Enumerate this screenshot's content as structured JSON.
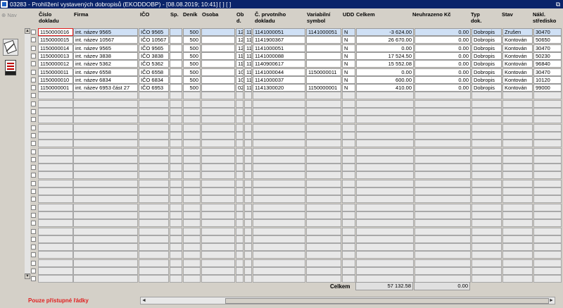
{
  "window": {
    "title": "03283 - Prohlížení vystavených dobropisů (EKODDOBP) - [08.08.2019; 10:41]  [ ]  [ ]"
  },
  "sidebar": {
    "nav_label": "Nav"
  },
  "columns": {
    "cislo": "Číslo\ndokladu",
    "firma": "Firma",
    "ico": "IČO",
    "sp": "Sp.",
    "denik": "Deník",
    "osoba": "Osoba",
    "obd": "Ob\nd.",
    "prvotni": "Č. prvotního\ndokladu",
    "varsym": "Variabilní\nsymbol",
    "udd": "UDD",
    "celkem": "Celkem",
    "neuhrazeno": "Neuhrazeno Kč",
    "typ": "Typ\ndok.",
    "stav": "Stav",
    "naklad": "Nákl.\nstředisko"
  },
  "rows": [
    {
      "cislo": "1150000016",
      "firma": "int. název 9565",
      "ico": "IČO 9565",
      "sp": "",
      "denik": "500",
      "osoba": "",
      "ob": "12",
      "d": "11",
      "prvotni": "1141000051",
      "varsym": "1141000051",
      "udd": "N",
      "celkem": "-3 624.00",
      "neuhrazeno": "0.00",
      "typ": "Dobropis",
      "stav": "Zrušen",
      "naklad": "30470"
    },
    {
      "cislo": "1150000015",
      "firma": "int. název 10567",
      "ico": "IČO 10567",
      "sp": "",
      "denik": "500",
      "osoba": "",
      "ob": "12",
      "d": "11",
      "prvotni": "1141900367",
      "varsym": "",
      "udd": "N",
      "celkem": "26 670.00",
      "neuhrazeno": "0.00",
      "typ": "Dobropis",
      "stav": "Kontován",
      "naklad": "50650"
    },
    {
      "cislo": "1150000014",
      "firma": "int. název 9565",
      "ico": "IČO 9565",
      "sp": "",
      "denik": "500",
      "osoba": "",
      "ob": "12",
      "d": "11",
      "prvotni": "1141000051",
      "varsym": "",
      "udd": "N",
      "celkem": "0.00",
      "neuhrazeno": "0.00",
      "typ": "Dobropis",
      "stav": "Kontován",
      "naklad": "30470"
    },
    {
      "cislo": "1150000013",
      "firma": "int. název 3838",
      "ico": "IČO 3838",
      "sp": "",
      "denik": "500",
      "osoba": "",
      "ob": "11",
      "d": "11",
      "prvotni": "1141000088",
      "varsym": "",
      "udd": "N",
      "celkem": "17 524.50",
      "neuhrazeno": "0.00",
      "typ": "Dobropis",
      "stav": "Kontován",
      "naklad": "50230"
    },
    {
      "cislo": "1150000012",
      "firma": "int. název 5362",
      "ico": "IČO 5362",
      "sp": "",
      "denik": "500",
      "osoba": "",
      "ob": "11",
      "d": "11",
      "prvotni": "1140900617",
      "varsym": "",
      "udd": "N",
      "celkem": "15 552.08",
      "neuhrazeno": "0.00",
      "typ": "Dobropis",
      "stav": "Kontován",
      "naklad": "96840"
    },
    {
      "cislo": "1150000011",
      "firma": "int. název 6558",
      "ico": "IČO 6558",
      "sp": "",
      "denik": "500",
      "osoba": "",
      "ob": "10",
      "d": "11",
      "prvotni": "1141000044",
      "varsym": "1150000011",
      "udd": "N",
      "celkem": "0.00",
      "neuhrazeno": "0.00",
      "typ": "Dobropis",
      "stav": "Kontován",
      "naklad": "30470"
    },
    {
      "cislo": "1150000010",
      "firma": "int. název 6834",
      "ico": "IČO 6834",
      "sp": "",
      "denik": "500",
      "osoba": "",
      "ob": "10",
      "d": "11",
      "prvotni": "1141000037",
      "varsym": "",
      "udd": "N",
      "celkem": "600.00",
      "neuhrazeno": "0.00",
      "typ": "Dobropis",
      "stav": "Kontován",
      "naklad": "10120"
    },
    {
      "cislo": "1150000001",
      "firma": "int. název 6953 část 27",
      "ico": "IČO 6953",
      "sp": "",
      "denik": "500",
      "osoba": "",
      "ob": "02",
      "d": "11",
      "prvotni": "1141300020",
      "varsym": "1150000001",
      "udd": "N",
      "celkem": "410.00",
      "neuhrazeno": "0.00",
      "typ": "Dobropis",
      "stav": "Kontován",
      "naklad": "99000"
    }
  ],
  "totals": {
    "label": "Celkem",
    "celkem": "57 132.58",
    "neuhrazeno": "0.00"
  },
  "status": {
    "text": "Pouze přístupné řádky"
  }
}
